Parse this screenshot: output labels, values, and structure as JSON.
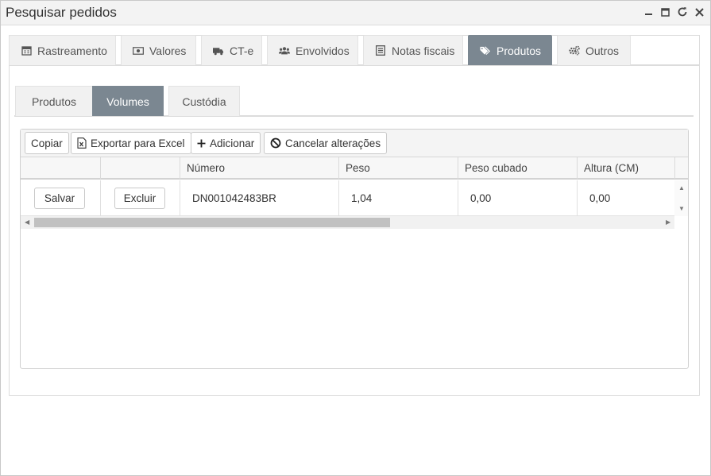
{
  "window": {
    "title": "Pesquisar pedidos",
    "controls": [
      "minimize-icon",
      "maximize-icon",
      "refresh-icon",
      "close-icon"
    ]
  },
  "main_tabs": [
    {
      "label": "Rastreamento",
      "icon": "calendar-icon",
      "active": false
    },
    {
      "label": "Valores",
      "icon": "money-icon",
      "active": false
    },
    {
      "label": "CT-e",
      "icon": "truck-icon",
      "active": false
    },
    {
      "label": "Envolvidos",
      "icon": "users-icon",
      "active": false
    },
    {
      "label": "Notas fiscais",
      "icon": "list-icon",
      "active": false
    },
    {
      "label": "Produtos",
      "icon": "tags-icon",
      "active": true
    },
    {
      "label": "Outros",
      "icon": "gears-icon",
      "active": false
    }
  ],
  "sub_tabs": [
    {
      "label": "Produtos",
      "active": false
    },
    {
      "label": "Volumes",
      "active": true
    },
    {
      "label": "Custódia",
      "active": false
    }
  ],
  "toolbar": {
    "copy_label": "Copiar",
    "export_label": "Exportar para Excel",
    "add_label": "Adicionar",
    "cancel_label": "Cancelar alterações"
  },
  "table": {
    "columns": [
      "",
      "",
      "Número",
      "Peso",
      "Peso cubado",
      "Altura (CM)"
    ],
    "rows": [
      {
        "save_label": "Salvar",
        "delete_label": "Excluir",
        "numero": "DN001042483BR",
        "peso": "1,04",
        "peso_cubado": "0,00",
        "altura": "0,00"
      }
    ]
  },
  "colors": {
    "active_tab": "#7b8791",
    "tab_bg": "#f1f1f1",
    "border": "#dcdcdc"
  }
}
